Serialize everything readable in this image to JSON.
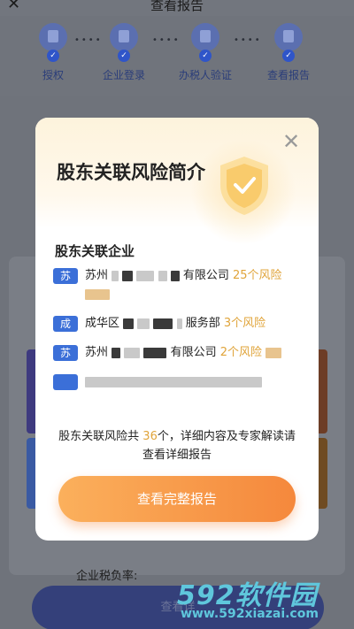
{
  "app": {
    "title": "查看报告",
    "back_icon": "back-arrow-icon"
  },
  "steps": [
    {
      "label": "授权",
      "icon": "authorize-shield-icon"
    },
    {
      "label": "企业登录",
      "icon": "enterprise-building-icon"
    },
    {
      "label": "办税人验证",
      "icon": "taxpayer-shield-icon"
    },
    {
      "label": "查看报告",
      "icon": "report-doc-icon"
    }
  ],
  "background": {
    "tax_rate_label": "企业税负率:",
    "bottom_button": "查看详"
  },
  "modal": {
    "title": "股东关联风险简介",
    "section_title": "股东关联企业",
    "items": [
      {
        "badge": "苏",
        "name_start": "苏州",
        "name_end": "有限公司",
        "risk": "25个风险"
      },
      {
        "badge": "成",
        "name_start": "成华区",
        "name_end": "服务部",
        "risk": "3个风险"
      },
      {
        "badge": "苏",
        "name_start": "苏州",
        "name_end": "有限公司",
        "risk": "2个风险"
      }
    ],
    "summary_prefix": "股东关联风险共",
    "summary_count": "36",
    "summary_suffix": "个，详细内容及专家解读请查看详细报告",
    "cta_label": "查看完整报告"
  },
  "watermark": {
    "main": "592软件园",
    "url": "www.592xiazai.com"
  },
  "colors": {
    "accent": "#f5883c",
    "risk": "#e0a43a",
    "badge": "#3b6fd8"
  }
}
